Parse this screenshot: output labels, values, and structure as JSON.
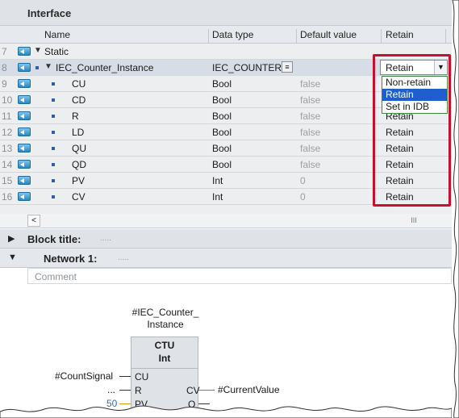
{
  "interface": {
    "title": "Interface",
    "columns": {
      "name": "Name",
      "data_type": "Data type",
      "default_value": "Default value",
      "retain": "Retain"
    },
    "rows": [
      {
        "num": "7",
        "name": "Static",
        "data_type": "",
        "default": "",
        "retain": ""
      },
      {
        "num": "8",
        "name": "IEC_Counter_Instance",
        "data_type": "IEC_COUNTER",
        "default": "",
        "retain": "Retain"
      },
      {
        "num": "9",
        "name": "CU",
        "data_type": "Bool",
        "default": "false",
        "retain": ""
      },
      {
        "num": "10",
        "name": "CD",
        "data_type": "Bool",
        "default": "false",
        "retain": ""
      },
      {
        "num": "11",
        "name": "R",
        "data_type": "Bool",
        "default": "false",
        "retain": "Retain"
      },
      {
        "num": "12",
        "name": "LD",
        "data_type": "Bool",
        "default": "false",
        "retain": "Retain"
      },
      {
        "num": "13",
        "name": "QU",
        "data_type": "Bool",
        "default": "false",
        "retain": "Retain"
      },
      {
        "num": "14",
        "name": "QD",
        "data_type": "Bool",
        "default": "false",
        "retain": "Retain"
      },
      {
        "num": "15",
        "name": "PV",
        "data_type": "Int",
        "default": "0",
        "retain": "Retain"
      },
      {
        "num": "16",
        "name": "CV",
        "data_type": "Int",
        "default": "0",
        "retain": "Retain"
      }
    ],
    "retain_dropdown": {
      "selected": "Retain",
      "options": [
        "Non-retain",
        "Retain",
        "Set in IDB"
      ],
      "highlighted": "Retain"
    },
    "scroll_left": "<",
    "scroll_thumb": "III"
  },
  "block_title": {
    "label": "Block title:",
    "placeholder": "....."
  },
  "network": {
    "label": "Network 1:",
    "placeholder": ".....",
    "comment": "Comment",
    "instance_name_line1": "#IEC_Counter_",
    "instance_name_line2": "Instance",
    "block_type": "CTU",
    "block_subtype": "Int",
    "pins": {
      "cu": "CU",
      "r": "R",
      "pv": "PV",
      "cv": "CV",
      "q": "Q",
      "cu_signal": "#CountSignal",
      "r_signal": "...",
      "pv_value": "50",
      "cv_output": "#CurrentValue"
    }
  },
  "colors": {
    "highlight_border": "#c8102e",
    "dropdown_selection": "#1f5ecf"
  }
}
